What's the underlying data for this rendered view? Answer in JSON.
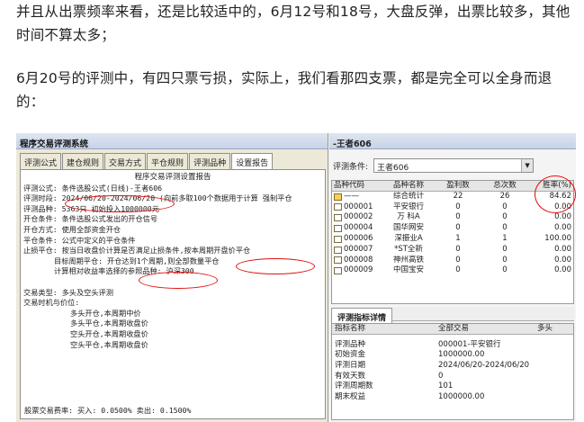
{
  "article": {
    "para1": "并且从出票频率来看，还是比较适中的，6月12号和18号，大盘反弹，出票比较多，其他时间不算太多；",
    "para2": "6月20号的评测中，有四只票亏损，实际上，我们看那四支票，都是完全可以全身而退的："
  },
  "left_window": {
    "title": "程序交易评测系统",
    "tabs": [
      "评测公式",
      "建仓规则",
      "交易方式",
      "平仓规则",
      "评测品种",
      "设置报告"
    ],
    "active_tab": "设置报告",
    "report": {
      "heading": "程序交易评测设置报告",
      "l1": "评测公式: 条件选股公式(日线)-王者606",
      "l2": "评测时段: 2024/06/20-2024/06/20 (向前多取100个数据用于计算 强制平仓",
      "l3": "评测品种: 5363只 初始投入1000000元",
      "l4": "开仓条件: 条件选股公式发出的开仓信号",
      "l5": "开仓方式: 使用全部资金开仓",
      "l6": "平仓条件: 公式中定义的平仓条件",
      "l7": "止损平仓: 按当日收盘价计算是否满足止损条件,按本周期开盘价平仓",
      "l8": "目标周期平仓: 开仓达到1个周期,则全部数量平仓",
      "l9": "计算相对收益率选择的参照品种: 沪深300",
      "l10": "交易类型: 多头及空头评测",
      "l11": "交易时机与价位:",
      "l12": "多头开仓,本周期中价",
      "l13": "多头平仓,本周期收盘价",
      "l14": "空头开仓,本周期收盘价",
      "l15": "空头平仓,本周期收盘价",
      "fee": "股票交易费率: 买入: 0.0500%  卖出: 0.1500%"
    }
  },
  "right_window": {
    "title": "-王者606",
    "cond_label": "评测条件:",
    "cond_value": "王者606",
    "columns": [
      "品种代码",
      "品种名称",
      "盈利数",
      "总次数",
      "胜率(%)"
    ],
    "rows": [
      {
        "code": "——",
        "name": "综合统计",
        "win": "22",
        "total": "26",
        "rate": "84.62",
        "icon": "folder-icon"
      },
      {
        "code": "000001",
        "name": "平安银行",
        "win": "0",
        "total": "0",
        "rate": "0.00",
        "icon": "doc-icon"
      },
      {
        "code": "000002",
        "name": "万 科A",
        "win": "0",
        "total": "0",
        "rate": "0.00",
        "icon": "doc-icon"
      },
      {
        "code": "000004",
        "name": "国华网安",
        "win": "0",
        "total": "0",
        "rate": "0.00",
        "icon": "doc-icon"
      },
      {
        "code": "000006",
        "name": "深振业A",
        "win": "1",
        "total": "1",
        "rate": "100.00",
        "icon": "doc-icon"
      },
      {
        "code": "000007",
        "name": "*ST全新",
        "win": "0",
        "total": "0",
        "rate": "0.00",
        "icon": "doc-icon"
      },
      {
        "code": "000008",
        "name": "神州高铁",
        "win": "0",
        "total": "0",
        "rate": "0.00",
        "icon": "doc-icon"
      },
      {
        "code": "000009",
        "name": "中国宝安",
        "win": "0",
        "total": "0",
        "rate": "0.00",
        "icon": "doc-icon"
      }
    ],
    "detail_tab": "评测指标详情",
    "detail_columns": [
      "指标名称",
      "全部交易",
      "多头"
    ],
    "detail_rows": [
      {
        "name": "评测品种",
        "value": "000001-平安银行"
      },
      {
        "name": "初始资金",
        "value": "1000000.00"
      },
      {
        "name": "评测日期",
        "value": "2024/06/20-2024/06/20"
      },
      {
        "name": "有效天数",
        "value": "0"
      },
      {
        "name": "评测周期数",
        "value": "101"
      },
      {
        "name": "期末权益",
        "value": "1000000.00"
      }
    ]
  },
  "colors": {
    "annotation": "#e01010",
    "title_bar": "#c6d2e6",
    "window_bg": "#ece9d8"
  }
}
